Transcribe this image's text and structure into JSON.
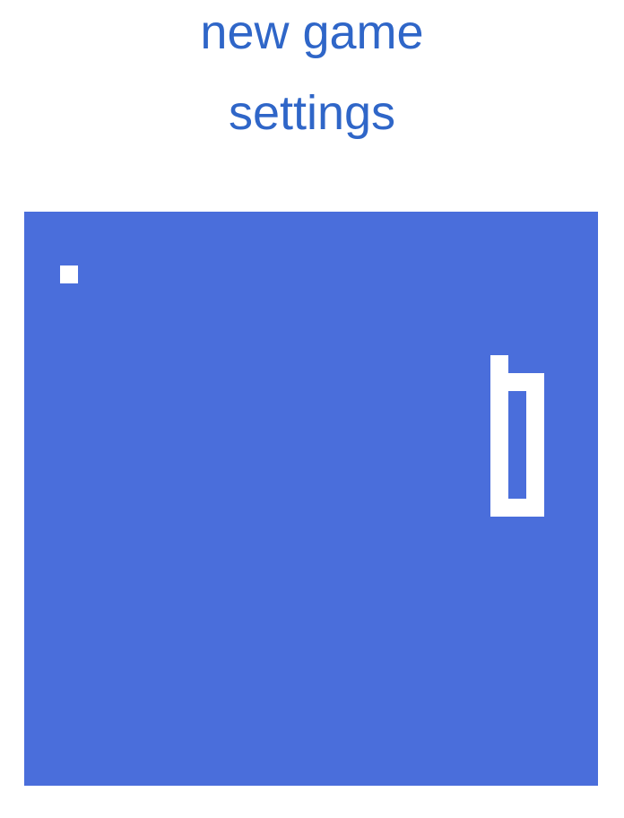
{
  "menu": {
    "new_game_label": "new game",
    "settings_label": "settings"
  },
  "colors": {
    "link": "#2f66c8",
    "board": "#4a6edb",
    "pieces": "#ffffff"
  },
  "game": {
    "grid": {
      "cols": 32,
      "rows": 32
    },
    "food": [
      2,
      3
    ],
    "snake": [
      [
        26,
        8
      ],
      [
        26,
        9
      ],
      [
        27,
        9
      ],
      [
        28,
        9
      ],
      [
        28,
        10
      ],
      [
        28,
        11
      ],
      [
        28,
        12
      ],
      [
        28,
        13
      ],
      [
        28,
        14
      ],
      [
        28,
        15
      ],
      [
        28,
        16
      ],
      [
        27,
        16
      ],
      [
        26,
        16
      ],
      [
        26,
        15
      ],
      [
        26,
        14
      ],
      [
        26,
        13
      ],
      [
        26,
        12
      ],
      [
        26,
        11
      ],
      [
        26,
        10
      ]
    ]
  }
}
